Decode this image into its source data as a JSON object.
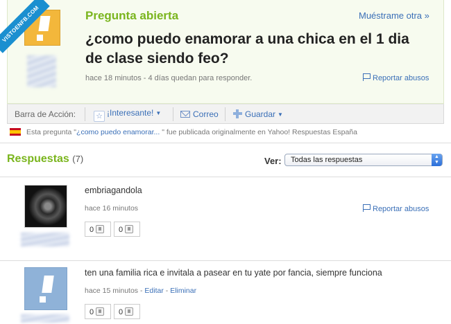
{
  "watermark": "VISTOENFB.COM",
  "question": {
    "type_label": "Pregunta abierta",
    "more_link": "Muéstrame otra",
    "more_arrow": "»",
    "title_line1": "¿como puedo enamorar a una chica en el 1 dia",
    "title_line2": "de clase siendo feo?",
    "meta": "hace 18 minutos - 4 días quedan para responder.",
    "report": "Reportar abusos"
  },
  "action_bar": {
    "label": "Barra de Acción:",
    "interesting": "¡Interesante!",
    "mail": "Correo",
    "save": "Guardar"
  },
  "origin": {
    "prefix": "Esta pregunta \"",
    "question_link": "¿como puedo enamorar... ",
    "suffix": "\" fue publicada originalmente en Yahoo! Respuestas España"
  },
  "answers_header": {
    "title": "Respuestas",
    "count": "(7)",
    "ver_label": "Ver:",
    "ver_selected": "Todas las respuestas"
  },
  "answers": [
    {
      "text": "embriagandola",
      "meta": "hace 16 minutos",
      "report": "Reportar abusos",
      "up_count": "0",
      "down_count": "0"
    },
    {
      "text": "ten una familia rica e invitala a pasear en tu yate por fancia, siempre funciona",
      "meta": "hace 15 minutos",
      "edit": "Editar",
      "delete": "Eliminar",
      "up_count": "0",
      "down_count": "0"
    }
  ],
  "colors": {
    "green_heading": "#7ab51d",
    "link_blue": "#3a6fb7",
    "question_bg": "#f7fbef",
    "avatar_orange": "#f3b73b",
    "avatar_blue": "#8fb2d8"
  }
}
